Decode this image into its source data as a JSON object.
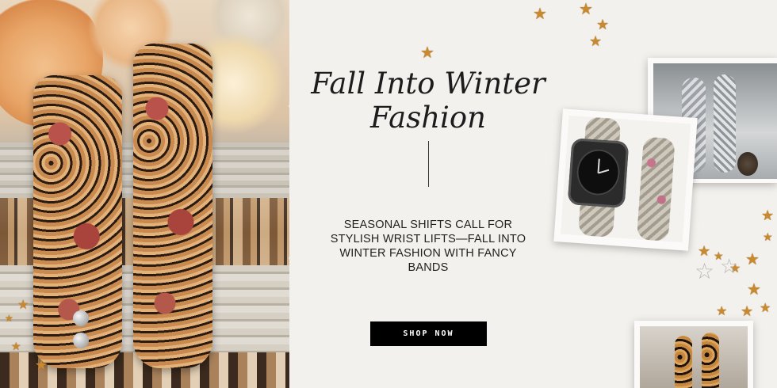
{
  "banner": {
    "headline": "Fall Into Winter\nFashion",
    "body": "SEASONAL SHIFTS CALL FOR STYLISH WRIST LIFTS—FALL INTO WINTER FASHION WITH FANCY BANDS",
    "cta_label": "SHOP NOW"
  },
  "colors": {
    "background": "#f3f1ed",
    "cta_background": "#000000",
    "cta_text": "#ffffff",
    "star_gold": "#c9892f"
  },
  "icons": {
    "decoration": "star-icon"
  }
}
